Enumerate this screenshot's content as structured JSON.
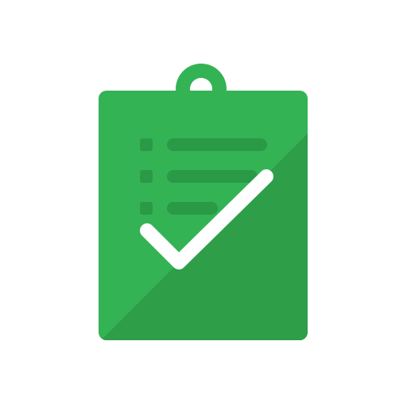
{
  "icon": {
    "name": "clipboard-checklist-icon",
    "colors": {
      "background": "#ffffff",
      "board": "#34b354",
      "board_shadow": "#2e9e49",
      "list_marks": "#2a9a47",
      "check": "#ffffff",
      "hanger_hole": "#ffffff"
    },
    "checklist_rows": 3
  }
}
